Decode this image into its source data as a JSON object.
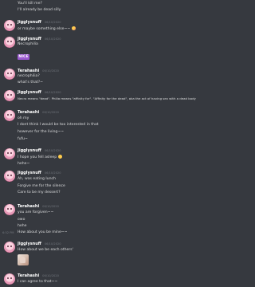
{
  "colors": {
    "background": "#36393f",
    "username": "#ffffff",
    "message_text": "#dcddde",
    "timestamp": "#72767d",
    "badge_purple": "#9b59d0"
  },
  "top_lines": [
    "You'll kill me?",
    "I'll already be dead silly"
  ],
  "groups": [
    {
      "author": "Jigglysnuff",
      "timestamp": "06/10/2020",
      "lines": [
        "or maybe something else~~"
      ],
      "emoji": "blush-emoji"
    },
    {
      "author": "Jigglysnuff",
      "timestamp": "06/10/2020",
      "lines": [
        "Necrophilia"
      ],
      "badge": "NICE"
    },
    {
      "author": "Terahashi",
      "timestamp": "06/10/2020",
      "lines": [
        "necrophilia?",
        "what's that?~"
      ]
    },
    {
      "author": "Jigglysnuff",
      "timestamp": "06/10/2020",
      "lines": [
        "Necro means \"dead\". Philia means \"affinity for\". \"Affinity for the dead\", aka the act of having sex with a dead body"
      ]
    },
    {
      "author": "Terahashi",
      "timestamp": "06/10/2020",
      "lines": [
        "oh my",
        "I dont think I would be too interested in that",
        "however for the living~~",
        "fufu~"
      ]
    },
    {
      "author": "Jigglysnuff",
      "timestamp": "06/10/2020",
      "lines": [
        "I hope you fell asleep",
        "hehe~"
      ],
      "emoji": "smile-emoji"
    },
    {
      "author": "Jigglysnuff",
      "timestamp": "06/10/2020",
      "lines": [
        "Ah, was eating lunch",
        "Forgive me for the silence",
        "Care to be my dessert?"
      ]
    },
    {
      "author": "Terahashi",
      "timestamp": "06/10/2020",
      "lines": [
        "you are forgiven~~",
        "owo",
        "hehe"
      ],
      "hover_line": "How about you be mine~~",
      "hover_time": "6:52 PM"
    },
    {
      "author": "Jigglysnuff",
      "timestamp": "06/10/2020",
      "lines": [
        "How about we be each others'"
      ],
      "image": "attached-image"
    },
    {
      "author": "Terahashi",
      "timestamp": "06/10/2020",
      "lines": [
        "I can agree to that~~"
      ]
    }
  ]
}
